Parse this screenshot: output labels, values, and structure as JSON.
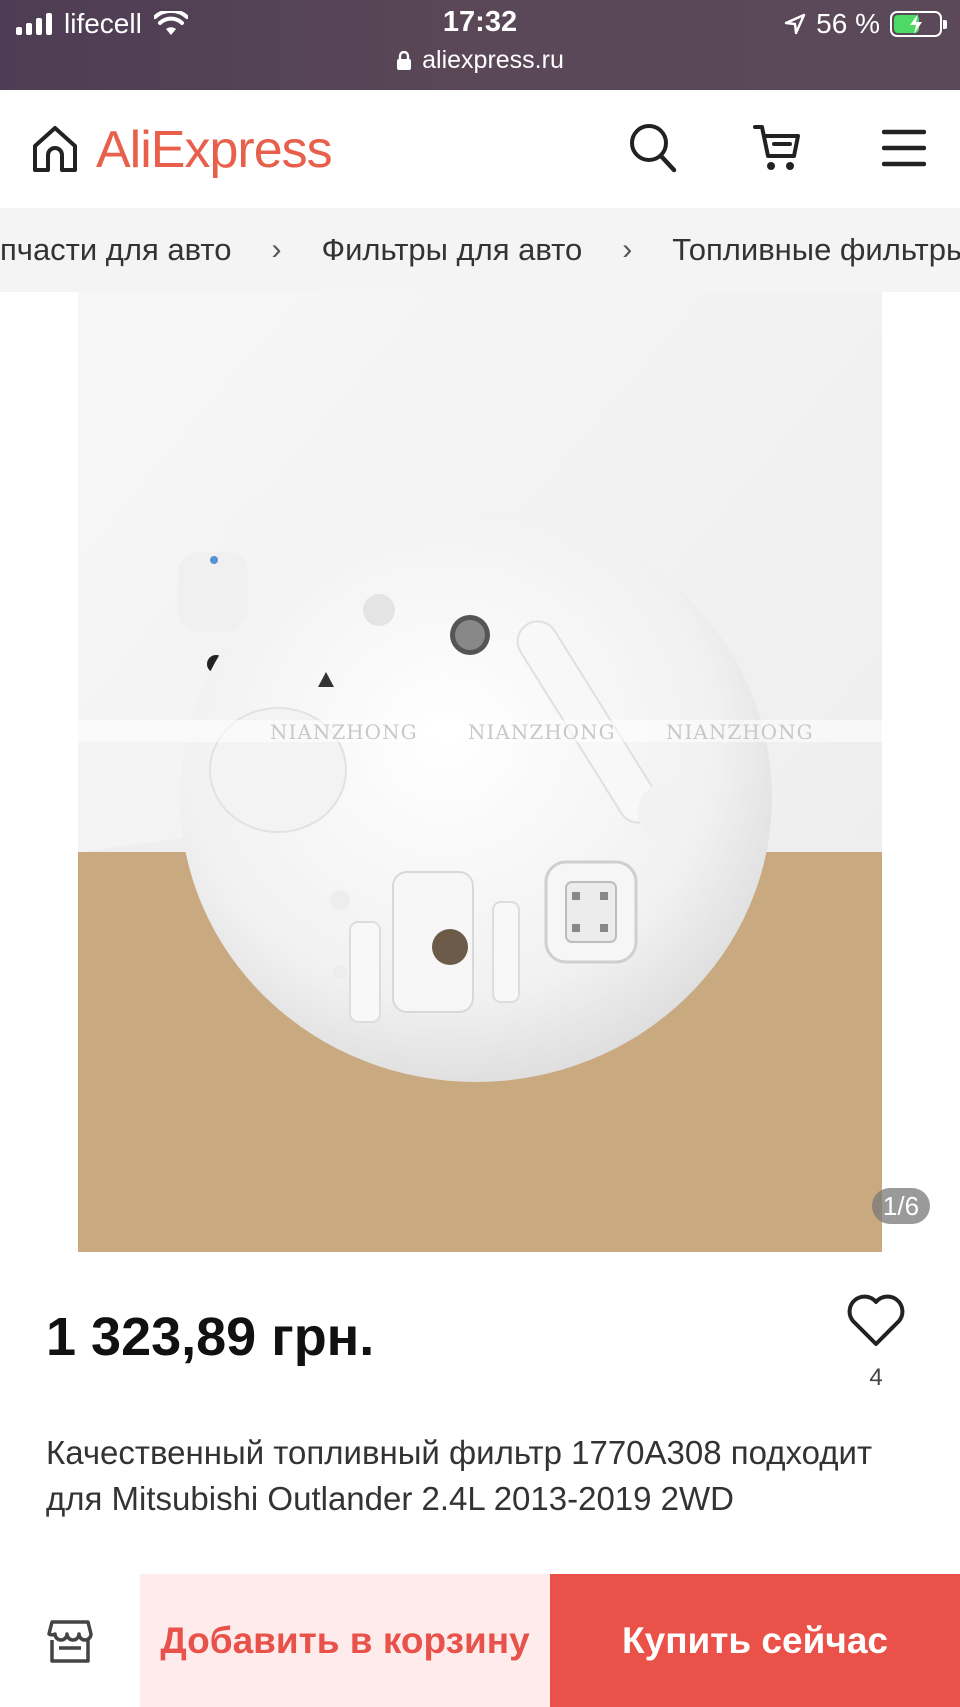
{
  "status_bar": {
    "carrier": "lifecell",
    "time": "17:32",
    "battery_percent": "56 %",
    "battery_level": 0.56,
    "url": "aliexpress.ru"
  },
  "header": {
    "brand": "AliExpress",
    "brand_color": "#e8604c",
    "icons": [
      "home-icon",
      "search-icon",
      "cart-icon",
      "menu-icon"
    ]
  },
  "breadcrumb": {
    "items": [
      "пчасти для авто",
      "Фильтры для авто",
      "Топливные фильтры"
    ],
    "separator": "›"
  },
  "gallery": {
    "watermark": "NIANZHONG",
    "counter": "1/6"
  },
  "product": {
    "price": "1 323,89 грн.",
    "favorites_count": "4",
    "title": "Качественный топливный фильтр 1770A308 подходит для Mitsubishi Outlander 2.4L 2013-2019 2WD"
  },
  "actions": {
    "add_to_cart": "Добавить в корзину",
    "buy_now": "Купить сейчас",
    "accent_color": "#ea5149"
  }
}
